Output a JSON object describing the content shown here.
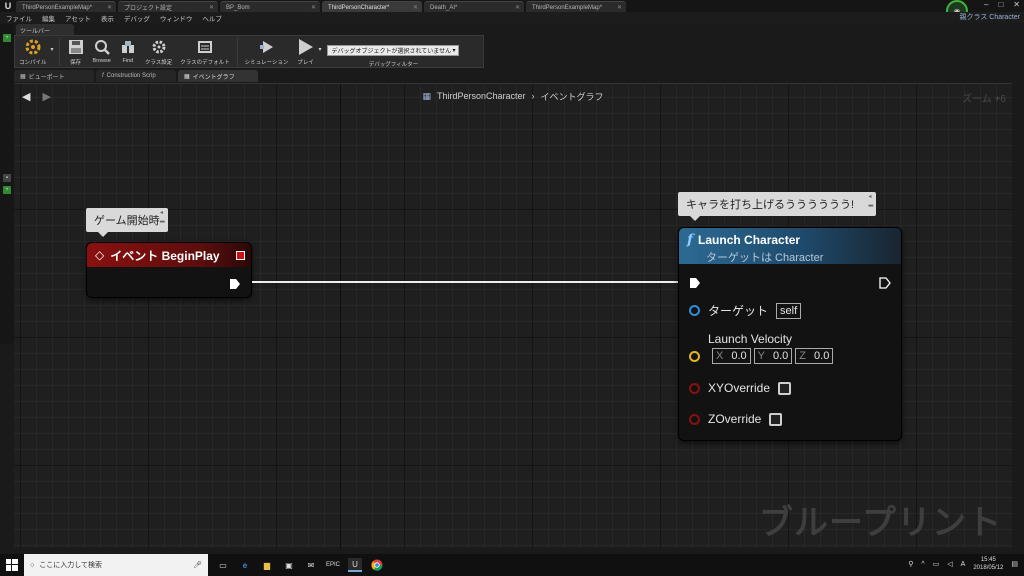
{
  "titlebar": {
    "tabs": [
      {
        "label": "ThirdPersonExampleMap*",
        "active": false
      },
      {
        "label": "プロジェクト設定",
        "active": false
      },
      {
        "label": "BP_Bom",
        "active": false
      },
      {
        "label": "ThirdPersonCharacter*",
        "active": true
      },
      {
        "label": "Death_AI*",
        "active": false
      },
      {
        "label": "ThirdPersonExampleMap*",
        "active": false
      }
    ],
    "parent_class": "親クラス Character"
  },
  "menubar": [
    "ファイル",
    "編集",
    "アセット",
    "表示",
    "デバッグ",
    "ウィンドウ",
    "ヘルプ"
  ],
  "toolbar": {
    "tab_label": "ツールバー",
    "buttons": [
      {
        "label": "コンパイル",
        "icon": "compile-icon"
      },
      {
        "label": "保存",
        "icon": "save-icon"
      },
      {
        "label": "Browse",
        "icon": "browse-icon"
      },
      {
        "label": "Find",
        "icon": "find-icon"
      },
      {
        "label": "クラス設定",
        "icon": "class-settings-icon"
      },
      {
        "label": "クラスのデフォルト",
        "icon": "class-defaults-icon"
      },
      {
        "label": "シミュレーション",
        "icon": "simulation-icon"
      },
      {
        "label": "プレイ",
        "icon": "play-icon"
      }
    ],
    "debug_filter_value": "デバッグオブジェクトが選択されていません",
    "debug_filter_label": "デバッグフィルター"
  },
  "subtabs": [
    {
      "label": "ビューポート",
      "icon": "viewport-icon"
    },
    {
      "label": "Construction Scrip",
      "icon": "function-icon"
    },
    {
      "label": "イベントグラフ",
      "icon": "graph-icon"
    }
  ],
  "graph": {
    "breadcrumb_root": "ThirdPersonCharacter",
    "breadcrumb_sep": "›",
    "breadcrumb_current": "イベントグラフ",
    "zoom": "ズーム +6",
    "watermark": "ブループリント"
  },
  "comments": {
    "begin_play": "ゲーム開始時",
    "launch": "キャラを打ち上げるうううううう!"
  },
  "nodes": {
    "begin_play": {
      "title": "イベント BeginPlay"
    },
    "launch": {
      "title": "Launch Character",
      "subtitle": "ターゲットは Character",
      "target_label": "ターゲット",
      "target_value": "self",
      "velocity_label": "Launch Velocity",
      "velocity": {
        "x_axis": "X",
        "x": "0.0",
        "y_axis": "Y",
        "y": "0.0",
        "z_axis": "Z",
        "z": "0.0"
      },
      "xy_override_label": "XYOverride",
      "z_override_label": "ZOverride"
    }
  },
  "taskbar": {
    "search_placeholder": "ここに入力して検索",
    "clock_time": "15:45",
    "clock_date": "2018/05/12"
  },
  "colors": {
    "event_header": "#8a1010",
    "function_header": "#2d6a93",
    "exec_pin": "#ffffff",
    "object_pin": "#2e8fd6",
    "vector_pin": "#e0b81a",
    "bool_pin": "#8a0f0f"
  }
}
